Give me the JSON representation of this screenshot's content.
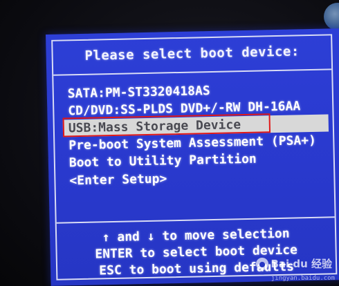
{
  "dialog": {
    "title": "Please select boot device:"
  },
  "boot_devices": [
    {
      "label": "SATA:PM-ST3320418AS",
      "selected": false
    },
    {
      "label": "CD/DVD:SS-PLDS DVD+/-RW DH-16AA",
      "selected": false
    },
    {
      "label": "USB:Mass Storage Device",
      "selected": true
    },
    {
      "label": "Pre-boot System Assessment (PSA+)",
      "selected": false
    },
    {
      "label": "Boot to Utility Partition",
      "selected": false
    }
  ],
  "setup_item": {
    "label": "<Enter Setup>"
  },
  "help": {
    "line1": "↑ and ↓ to move selection",
    "line2": "ENTER to select boot device",
    "line3": "ESC to boot using defaults"
  },
  "watermark": {
    "brand": "Bai du 经验",
    "sub": "jingyan.baidu.com"
  },
  "colors": {
    "bios_background": "#2a3ad0",
    "selection_highlight": "#d8d8d8",
    "annotation_box": "#e01818",
    "text": "#ffffff"
  }
}
